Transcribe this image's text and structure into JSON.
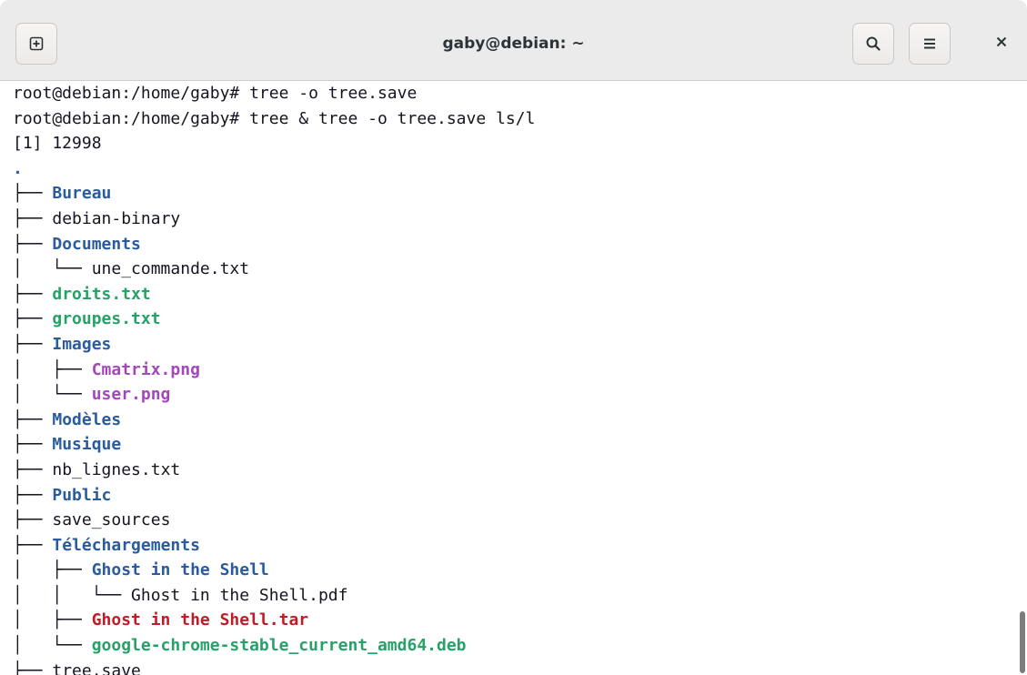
{
  "window": {
    "title": "gaby@debian: ~"
  },
  "titlebar": {
    "new_tab_icon": "new-tab-icon",
    "search_icon": "search-icon",
    "menu_icon": "hamburger-menu-icon",
    "close_icon": "close-icon"
  },
  "terminal": {
    "lines": [
      {
        "prefix": "",
        "text": "root@debian:/home/gaby# tree -o tree.save",
        "style": "plain"
      },
      {
        "prefix": "",
        "text": "root@debian:/home/gaby# tree & tree -o tree.save ls/l",
        "style": "plain"
      },
      {
        "prefix": "",
        "text": "[1] 12998",
        "style": "plain"
      },
      {
        "prefix": "",
        "text": ".",
        "style": "dot"
      },
      {
        "prefix": "├── ",
        "text": "Bureau",
        "style": "dir"
      },
      {
        "prefix": "├── ",
        "text": "debian-binary",
        "style": "plain"
      },
      {
        "prefix": "├── ",
        "text": "Documents",
        "style": "dir"
      },
      {
        "prefix": "│   └── ",
        "text": "une_commande.txt",
        "style": "plain"
      },
      {
        "prefix": "├── ",
        "text": "droits.txt",
        "style": "exe"
      },
      {
        "prefix": "├── ",
        "text": "groupes.txt",
        "style": "exe"
      },
      {
        "prefix": "├── ",
        "text": "Images",
        "style": "dir"
      },
      {
        "prefix": "│   ├── ",
        "text": "Cmatrix.png",
        "style": "img"
      },
      {
        "prefix": "│   └── ",
        "text": "user.png",
        "style": "img"
      },
      {
        "prefix": "├── ",
        "text": "Modèles",
        "style": "dir"
      },
      {
        "prefix": "├── ",
        "text": "Musique",
        "style": "dir"
      },
      {
        "prefix": "├── ",
        "text": "nb_lignes.txt",
        "style": "plain"
      },
      {
        "prefix": "├── ",
        "text": "Public",
        "style": "dir"
      },
      {
        "prefix": "├── ",
        "text": "save_sources",
        "style": "plain"
      },
      {
        "prefix": "├── ",
        "text": "Téléchargements",
        "style": "dir"
      },
      {
        "prefix": "│   ├── ",
        "text": "Ghost in the Shell",
        "style": "dir"
      },
      {
        "prefix": "│   │   └── ",
        "text": "Ghost in the Shell.pdf",
        "style": "plain"
      },
      {
        "prefix": "│   ├── ",
        "text": "Ghost in the Shell.tar",
        "style": "arc"
      },
      {
        "prefix": "│   └── ",
        "text": "google-chrome-stable_current_amd64.deb",
        "style": "exe"
      },
      {
        "prefix": "├── ",
        "text": "tree.save",
        "style": "plain"
      }
    ]
  },
  "colors": {
    "directory": "#2a5b9e",
    "executable": "#26a269",
    "image": "#a347ba",
    "archive": "#c01c28",
    "foreground": "#171421",
    "background": "#ffffff",
    "titlebar": "#ebebeb"
  }
}
